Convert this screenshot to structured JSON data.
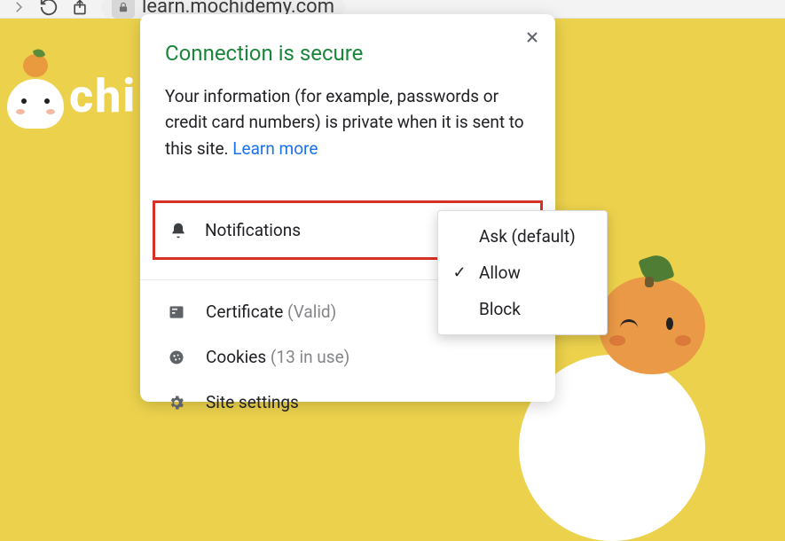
{
  "toolbar": {
    "url": "learn.mochidemy.com"
  },
  "logo": {
    "text_part": "chi"
  },
  "popup": {
    "title": "Connection is secure",
    "description_1": "Your information (for example, passwords or credit card numbers) is private when it is sent to this site. ",
    "learn_more": "Learn more",
    "permission": {
      "label": "Notifications",
      "selected": "Allow"
    },
    "info_rows": [
      {
        "label": "Certificate",
        "note": "(Valid)"
      },
      {
        "label": "Cookies",
        "note": "(13 in use)"
      },
      {
        "label": "Site settings",
        "note": ""
      }
    ]
  },
  "dropdown": {
    "options": [
      {
        "label": "Ask (default)",
        "checked": false
      },
      {
        "label": "Allow",
        "checked": true
      },
      {
        "label": "Block",
        "checked": false
      }
    ]
  }
}
